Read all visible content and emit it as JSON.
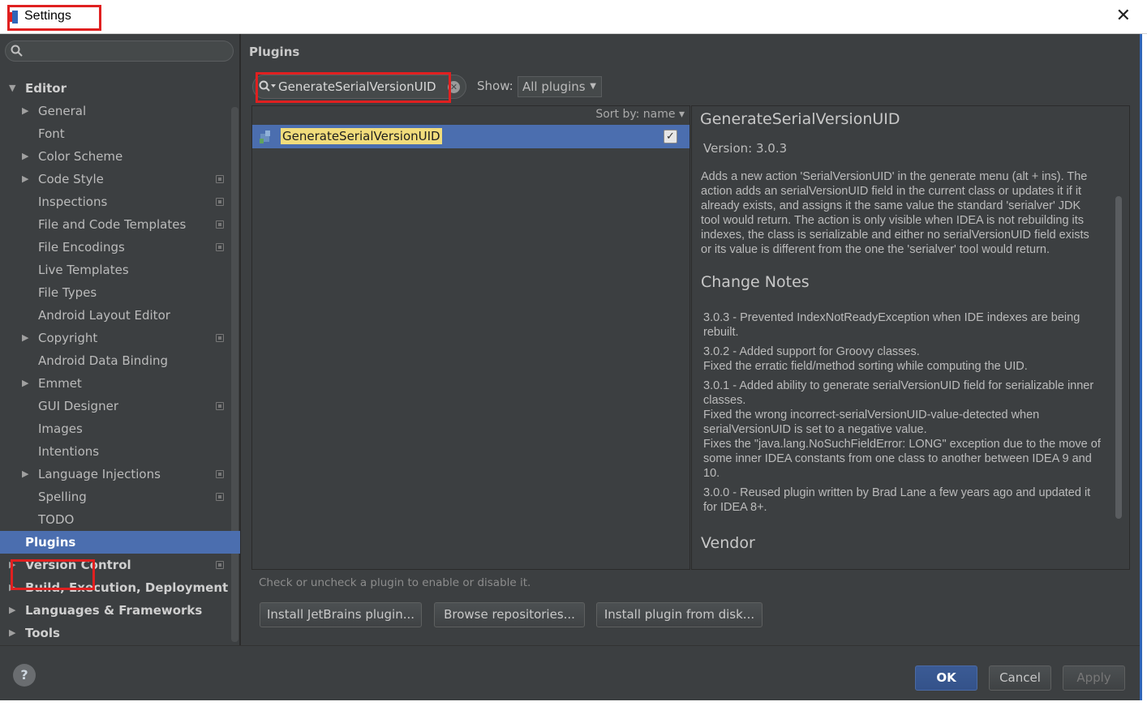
{
  "window": {
    "title": "Settings",
    "close_glyph": "✕"
  },
  "sidebar": {
    "search_placeholder": "",
    "items": [
      {
        "label": "Editor",
        "arrow": "▼",
        "level": 0,
        "bold": true
      },
      {
        "label": "General",
        "arrow": "▶",
        "level": 1
      },
      {
        "label": "Font",
        "arrow": "",
        "level": 1
      },
      {
        "label": "Color Scheme",
        "arrow": "▶",
        "level": 1
      },
      {
        "label": "Code Style",
        "arrow": "▶",
        "level": 1,
        "project": true
      },
      {
        "label": "Inspections",
        "arrow": "",
        "level": 1,
        "project": true
      },
      {
        "label": "File and Code Templates",
        "arrow": "",
        "level": 1,
        "project": true
      },
      {
        "label": "File Encodings",
        "arrow": "",
        "level": 1,
        "project": true
      },
      {
        "label": "Live Templates",
        "arrow": "",
        "level": 1
      },
      {
        "label": "File Types",
        "arrow": "",
        "level": 1
      },
      {
        "label": "Android Layout Editor",
        "arrow": "",
        "level": 1
      },
      {
        "label": "Copyright",
        "arrow": "▶",
        "level": 1,
        "project": true
      },
      {
        "label": "Android Data Binding",
        "arrow": "",
        "level": 1
      },
      {
        "label": "Emmet",
        "arrow": "▶",
        "level": 1
      },
      {
        "label": "GUI Designer",
        "arrow": "",
        "level": 1,
        "project": true
      },
      {
        "label": "Images",
        "arrow": "",
        "level": 1
      },
      {
        "label": "Intentions",
        "arrow": "",
        "level": 1
      },
      {
        "label": "Language Injections",
        "arrow": "▶",
        "level": 1,
        "project": true
      },
      {
        "label": "Spelling",
        "arrow": "",
        "level": 1,
        "project": true
      },
      {
        "label": "TODO",
        "arrow": "",
        "level": 1
      },
      {
        "label": "Plugins",
        "arrow": "",
        "level": 0,
        "bold": true,
        "selected": true
      },
      {
        "label": "Version Control",
        "arrow": "▶",
        "level": 0,
        "bold": true,
        "project": true
      },
      {
        "label": "Build, Execution, Deployment",
        "arrow": "▶",
        "level": 0,
        "bold": true
      },
      {
        "label": "Languages & Frameworks",
        "arrow": "▶",
        "level": 0,
        "bold": true
      },
      {
        "label": "Tools",
        "arrow": "▶",
        "level": 0,
        "bold": true
      }
    ]
  },
  "plugins": {
    "heading": "Plugins",
    "search_value": "GenerateSerialVersionUID",
    "show_label": "Show:",
    "show_value": "All plugins",
    "sort_label": "Sort by: name",
    "list": [
      {
        "name": "GenerateSerialVersionUID",
        "enabled": true
      }
    ],
    "hint": "Check or uncheck a plugin to enable or disable it.",
    "buttons": {
      "install_jetbrains": "Install JetBrains plugin...",
      "browse": "Browse repositories...",
      "install_disk": "Install plugin from disk..."
    }
  },
  "details": {
    "name": "GenerateSerialVersionUID",
    "version": "Version: 3.0.3",
    "description": "Adds a new action 'SerialVersionUID' in the generate menu (alt + ins). The action adds an serialVersionUID field in the current class or updates it if it already exists, and assigns it the same value the standard 'serialver' JDK tool would return. The action is only visible when IDEA is not rebuilding its indexes, the class is serializable and either no serialVersionUID field exists or its value is different from the one the 'serialver' tool would return.",
    "change_notes_heading": "Change Notes",
    "change_notes": [
      "3.0.3 - Prevented IndexNotReadyException when IDE indexes are being rebuilt.",
      "3.0.2 - Added support for Groovy classes.\nFixed the erratic field/method sorting while computing the UID.",
      "3.0.1 - Added ability to generate serialVersionUID field for serializable inner classes.\nFixed the wrong incorrect-serialVersionUID-value-detected when serialVersionUID is set to a negative value.\nFixes the \"java.lang.NoSuchFieldError: LONG\" exception due to the move of some inner IDEA constants from one class to another between IDEA 9 and 10.",
      "3.0.0 - Reused plugin written by Brad Lane a few years ago and updated it for IDEA 8+."
    ],
    "vendor_heading": "Vendor"
  },
  "footer": {
    "help_glyph": "?",
    "ok": "OK",
    "cancel": "Cancel",
    "apply": "Apply"
  },
  "colors": {
    "selection": "#4b6eaf",
    "highlight_box": "#e02020",
    "search_match": "#f1dc7b"
  }
}
